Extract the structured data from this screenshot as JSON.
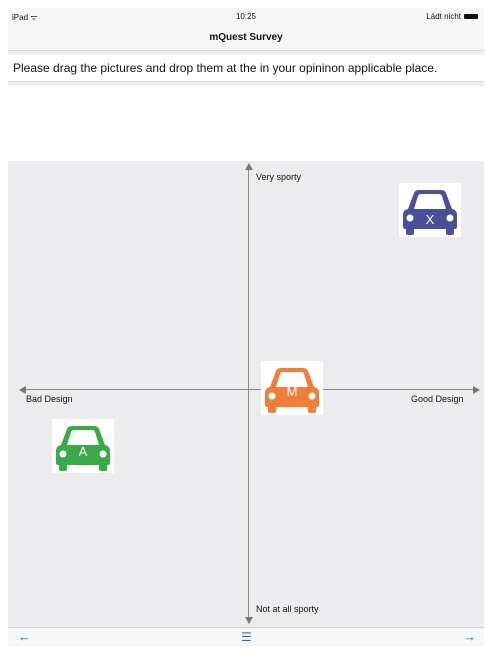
{
  "status_bar": {
    "device": "iPad ᯤ",
    "time": "10:25",
    "battery_text": "Lädt nicht"
  },
  "nav": {
    "title": "mQuest Survey"
  },
  "instruction": "Please drag the pictures and drop them at the in your opininon applicable place.",
  "axes": {
    "top": "Very sporty",
    "bottom": "Not at all sporty",
    "left": "Bad Design",
    "right": "Good Design"
  },
  "cars": [
    {
      "letter": "X",
      "color": "#4a4f9a"
    },
    {
      "letter": "M",
      "color": "#f07d3a"
    },
    {
      "letter": "A",
      "color": "#3aaa48"
    }
  ],
  "toolbar": {
    "back": "←",
    "list": "☰",
    "forward": "→"
  }
}
